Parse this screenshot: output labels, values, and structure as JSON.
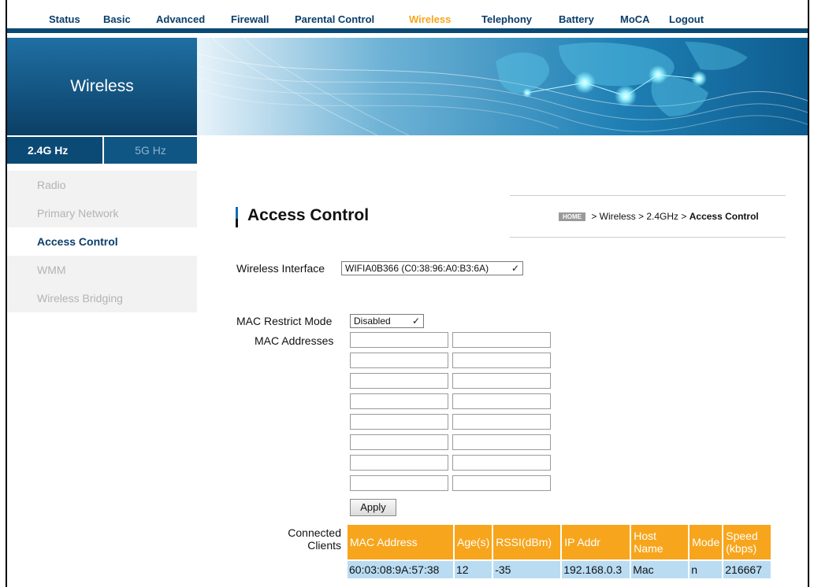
{
  "nav": {
    "items": [
      {
        "label": "Status",
        "active": false
      },
      {
        "label": "Basic",
        "active": false
      },
      {
        "label": "Advanced",
        "active": false
      },
      {
        "label": "Firewall",
        "active": false
      },
      {
        "label": "Parental Control",
        "active": false
      },
      {
        "label": "Wireless",
        "active": true
      },
      {
        "label": "Telephony",
        "active": false
      },
      {
        "label": "Battery",
        "active": false
      },
      {
        "label": "MoCA",
        "active": false
      },
      {
        "label": "Logout",
        "active": false
      }
    ]
  },
  "banner": {
    "title": "Wireless"
  },
  "bands": {
    "active": "2.4G Hz",
    "inactive": "5G Hz"
  },
  "sidebar": {
    "items": [
      {
        "label": "Radio",
        "active": false
      },
      {
        "label": "Primary Network",
        "active": false
      },
      {
        "label": "Access Control",
        "active": true
      },
      {
        "label": "WMM",
        "active": false
      },
      {
        "label": "Wireless Bridging",
        "active": false
      }
    ]
  },
  "page": {
    "title": "Access Control"
  },
  "breadcrumb": {
    "home": "HOME",
    "path": "> Wireless > 2.4GHz >",
    "current": "Access Control"
  },
  "form": {
    "interface_label": "Wireless Interface",
    "interface_value": "WIFIA0B366 (C0:38:96:A0:B3:6A)",
    "restrict_label": "MAC Restrict Mode",
    "restrict_value": "Disabled",
    "mac_label": "MAC Addresses",
    "apply_label": "Apply"
  },
  "clients": {
    "label": "Connected Clients",
    "headers": [
      "MAC Address",
      "Age(s)",
      "RSSI(dBm)",
      "IP Addr",
      "Host Name",
      "Mode",
      "Speed (kbps)"
    ],
    "rows": [
      [
        "60:03:08:9A:57:38",
        "12",
        "-35",
        "192.168.0.3",
        "Mac",
        "n",
        "216667"
      ]
    ]
  },
  "colors": {
    "accent": "#f7a51c",
    "navy": "#0b4a75",
    "row": "#b9dcf3"
  }
}
